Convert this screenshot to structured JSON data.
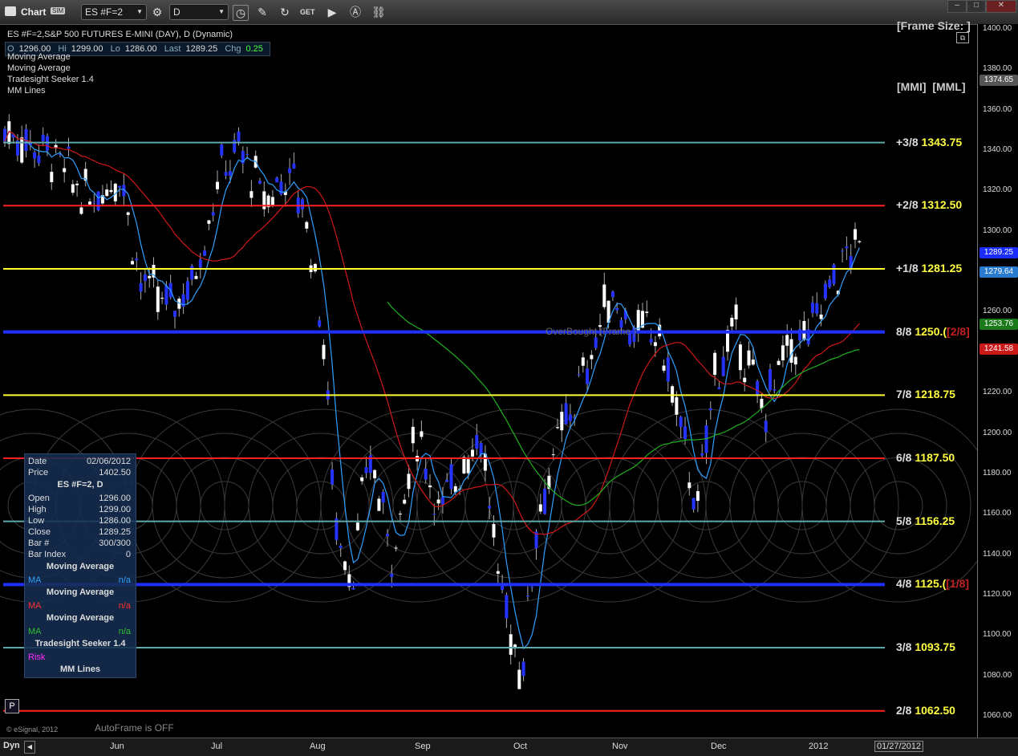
{
  "toolbar": {
    "app_title": "Chart",
    "sim_badge": "SIM",
    "symbol": "ES #F=2",
    "interval": "D",
    "tool_icons": [
      "pencil-icon",
      "refresh-icon",
      "get-icon",
      "play-icon",
      "alert-icon",
      "link-icon"
    ]
  },
  "chart": {
    "title": "ES #F=2,S&P 500 FUTURES E-MINI (DAY), D (Dynamic)",
    "ohlc": {
      "o_label": "O",
      "o": "1296.00",
      "h_label": "Hi",
      "h": "1299.00",
      "l_label": "Lo",
      "l": "1286.00",
      "last_label": "Last",
      "last": "1289.25",
      "chg_label": "Chg",
      "chg": "0.25"
    },
    "studies": [
      "Moving Average",
      "Moving Average",
      "Moving Average",
      "Tradesight Seeker 1.4",
      "MM Lines"
    ],
    "frame_size": "[Frame Size: ]",
    "mmi_header": "[MMI]  [MML]",
    "overbought_text": "OverBought (Frame  )",
    "autoframe": "AutoFrame is OFF",
    "copyright": "© eSignal, 2012",
    "p_button": "P"
  },
  "mm_lines": [
    {
      "label": "+3/8",
      "value": "1343.75",
      "price": 1343.75,
      "color": "#5fa8a8"
    },
    {
      "label": "+2/8",
      "value": "1312.50",
      "price": 1312.5,
      "color": "#ff2020"
    },
    {
      "label": "+1/8",
      "value": "1281.25",
      "price": 1281.25,
      "color": "#ffff30"
    },
    {
      "label": "8/8",
      "value": "1250.(",
      "price": 1250.0,
      "color": "#2030ff",
      "extra": "[2/8]"
    },
    {
      "label": "7/8",
      "value": "1218.75",
      "price": 1218.75,
      "color": "#ffff30"
    },
    {
      "label": "6/8",
      "value": "1187.50",
      "price": 1187.5,
      "color": "#ff2020"
    },
    {
      "label": "5/8",
      "value": "1156.25",
      "price": 1156.25,
      "color": "#5fa8a8"
    },
    {
      "label": "4/8",
      "value": "1125.(",
      "price": 1125.0,
      "color": "#2030ff",
      "extra": "[1/8]"
    },
    {
      "label": "3/8",
      "value": "1093.75",
      "price": 1093.75,
      "color": "#5fa8a8"
    },
    {
      "label": "2/8",
      "value": "1062.50",
      "price": 1062.5,
      "color": "#ff2020"
    }
  ],
  "y_axis": {
    "ticks": [
      "1400.00",
      "1380.00",
      "1360.00",
      "1340.00",
      "1320.00",
      "1300.00",
      "1280.00",
      "1260.00",
      "1240.00",
      "1220.00",
      "1200.00",
      "1180.00",
      "1160.00",
      "1140.00",
      "1120.00",
      "1100.00",
      "1080.00",
      "1060.00"
    ],
    "tags": [
      {
        "text": "1374.65",
        "price": 1374.65,
        "bg": "#555555"
      },
      {
        "text": "1289.25",
        "price": 1289.25,
        "bg": "#1a2cff"
      },
      {
        "text": "1279.64",
        "price": 1279.64,
        "bg": "#2a7bd0"
      },
      {
        "text": "1253.76",
        "price": 1253.76,
        "bg": "#1c7a1c"
      },
      {
        "text": "1241.58",
        "price": 1241.58,
        "bg": "#cc1a1a"
      }
    ]
  },
  "x_axis": {
    "dyn": "Dyn",
    "months": [
      "Jun",
      "Jul",
      "Aug",
      "Sep",
      "Oct",
      "Nov",
      "Dec",
      "2012"
    ],
    "current_date": "01/27/2012"
  },
  "data_window": {
    "date_label": "Date",
    "date": "02/06/2012",
    "price_label": "Price",
    "price": "1402.50",
    "symbol": "ES #F=2, D",
    "rows": [
      {
        "k": "Open",
        "v": "1296.00"
      },
      {
        "k": "High",
        "v": "1299.00"
      },
      {
        "k": "Low",
        "v": "1286.00"
      },
      {
        "k": "Close",
        "v": "1289.25"
      },
      {
        "k": "Bar #",
        "v": "300/300"
      },
      {
        "k": "Bar Index",
        "v": "0"
      }
    ],
    "ma_header": "Moving Average",
    "ma_label": "MA",
    "na": "n/a",
    "seeker_header": "Tradesight Seeker 1.4",
    "risk_label": "Risk",
    "mm_header": "MM Lines"
  },
  "colors": {
    "ma_blue": "#2fa0ff",
    "ma_red": "#d01818",
    "ma_green": "#20b020",
    "bull": "#ffffff",
    "bear": "#2633ff"
  }
}
